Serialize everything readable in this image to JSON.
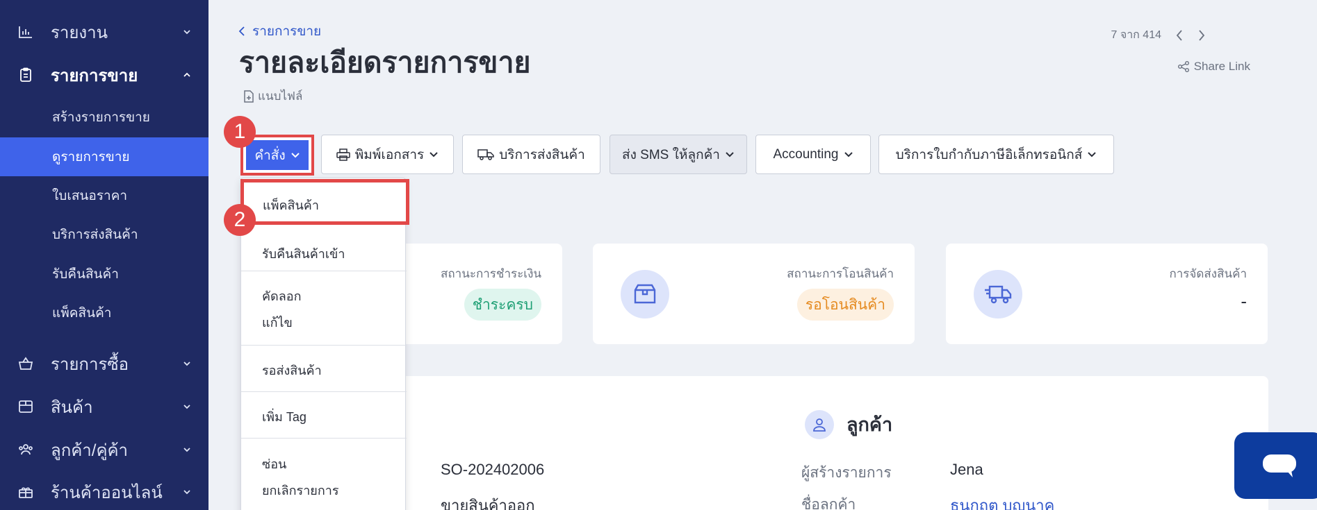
{
  "sidebar": {
    "reports": "รายงาน",
    "sales": "รายการขาย",
    "sales_sub": [
      "สร้างรายการขาย",
      "ดูรายการขาย",
      "ใบเสนอราคา",
      "บริการส่งสินค้า",
      "รับคืนสินค้า",
      "แพ็คสินค้า"
    ],
    "purchases": "รายการซื้อ",
    "products": "สินค้า",
    "contacts": "ลูกค้า/คู่ค้า",
    "online_store": "ร้านค้าออนไลน์"
  },
  "header": {
    "breadcrumb": "รายการขาย",
    "title": "รายละเอียดรายการขาย",
    "attach": "แนบไฟล์",
    "pager": "7 จาก 414",
    "share": "Share Link"
  },
  "toolbar": {
    "command": "คำสั่ง",
    "print": "พิมพ์เอกสาร",
    "shipping": "บริการส่งสินค้า",
    "sms": "ส่ง SMS ให้ลูกค้า",
    "accounting": "Accounting",
    "etax": "บริการใบกำกับภาษีอิเล็กทรอนิกส์"
  },
  "steps": [
    "1",
    "2"
  ],
  "dropdown": {
    "pack": "แพ็คสินค้า",
    "return": "รับคืนสินค้าเข้า",
    "copy": "คัดลอก",
    "edit": "แก้ไข",
    "await": "รอส่งสินค้า",
    "tag": "เพิ่ม Tag",
    "hide": "ซ่อน",
    "cancel": "ยกเลิกรายการ"
  },
  "cards": {
    "payment_title": "สถานะการชำระเงิน",
    "payment_status": "ชำระครบ",
    "transfer_title": "สถานะการโอนสินค้า",
    "transfer_status": "รอโอนสินค้า",
    "delivery_title": "การจัดส่งสินค้า",
    "delivery_value": "-"
  },
  "detail": {
    "customer_heading": "ลูกค้า",
    "doc_no": "SO-202402006",
    "doc_type": "ขายสินค้าออก",
    "creator_label": "ผู้สร้างรายการ",
    "creator_value": "Jena",
    "customer_label": "ชื่อลูกค้า",
    "customer_value": "ธนกฤต บุญนาค"
  },
  "colors": {
    "sidebar": "#1f2a63",
    "accent": "#3f63ea",
    "marker": "#e24848",
    "chat": "#0d3c9e"
  }
}
